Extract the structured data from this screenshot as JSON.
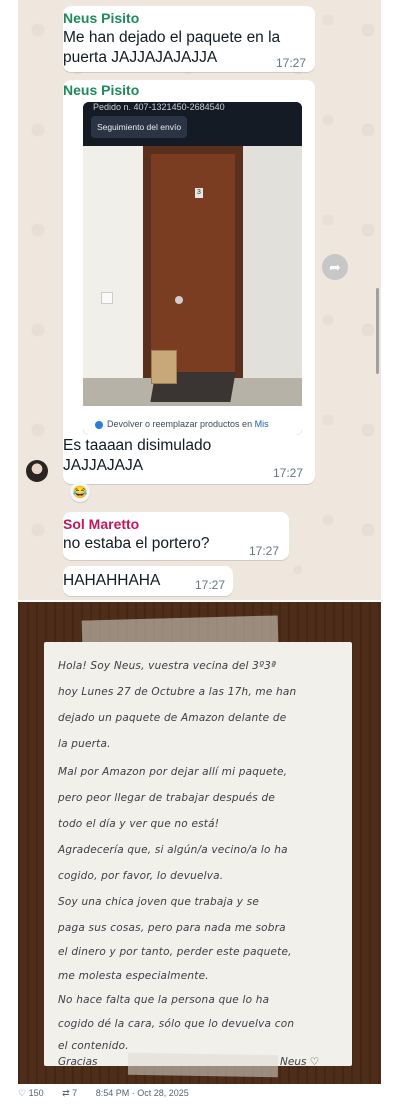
{
  "chat": {
    "messages": [
      {
        "sender": "Neus Pisito",
        "text_lines": [
          "Me han dejado el paquete en la",
          "puerta JAJJAJAJAJJA"
        ],
        "time": "17:27"
      },
      {
        "sender": "Neus Pisito",
        "image": {
          "top_text": "Pedido n. 407-1321450-2684540",
          "button": "Seguimiento del envío",
          "door_number": "3",
          "footer_text": "Devolver o reemplazar productos en ",
          "footer_link": "Mis"
        },
        "text_lines": [
          "Es taaaan disimulado",
          "JAJJAJAJA"
        ],
        "time": "17:27",
        "reaction": "😂"
      },
      {
        "sender": "Sol Maretto",
        "text": "no estaba el portero?",
        "time": "17:27"
      },
      {
        "text": "HAHAHHAHA",
        "time": "17:27"
      }
    ],
    "forward_icon": "forward-arrow-icon"
  },
  "note": {
    "lines": [
      "Hola! Soy Neus, vuestra vecina del 3º3ª",
      "hoy Lunes 27 de Octubre a las 17h, me han",
      "dejado un paquete de Amazon delante de",
      "la puerta.",
      "Mal por Amazon por dejar allí mi paquete,",
      "pero peor llegar de trabajar después de",
      "todo el día y ver que no está!",
      "Agradecería que, si algún/a vecino/a lo ha",
      "cogido, por favor, lo devuelva.",
      "Soy una chica joven que trabaja y se",
      "paga sus cosas, pero para nada me sobra",
      "el dinero y por tanto, perder este paquete,",
      "me molesta especialmente.",
      "No hace falta que la persona que lo ha",
      "cogido dé la cara, sólo que lo devuelva con",
      "el contenido."
    ],
    "closing": "Gracias",
    "signature": "Neus ♡"
  },
  "tweet": {
    "likes": "150",
    "reposts": "7",
    "timestamp": "8:54 PM · Oct 28, 2025"
  }
}
